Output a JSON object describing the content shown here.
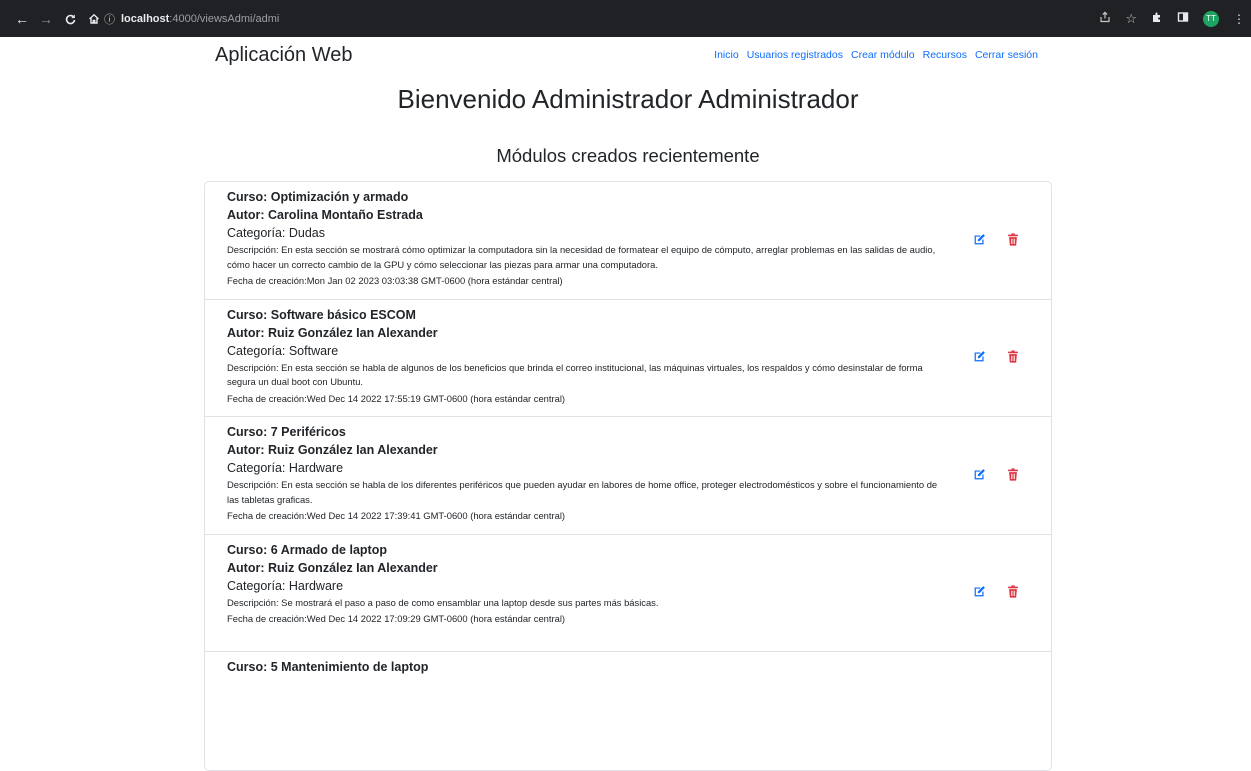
{
  "browser": {
    "url_host": "localhost",
    "url_path": ":4000/viewsAdmi/admi",
    "profile_initials": "TT"
  },
  "navbar": {
    "brand": "Aplicación Web",
    "links": [
      "Inicio",
      "Usuarios registrados",
      "Crear módulo",
      "Recursos",
      "Cerrar sesión"
    ]
  },
  "main": {
    "welcome": "Bienvenido Administrador Administrador",
    "subtitle": "Módulos creados recientemente"
  },
  "modules": [
    {
      "curso": "Curso: Optimización y armado",
      "autor": "Autor: Carolina Montaño Estrada",
      "categoria": "Categoría: Dudas",
      "descripcion": "Descripción: En esta sección se mostrará cómo optimizar la computadora sin la necesidad de formatear el equipo de cómputo, arreglar problemas en las salidas de audio, cómo hacer un correcto cambio de la GPU y cómo seleccionar las piezas para armar una computadora.",
      "fecha": "Fecha de creación:Mon Jan 02 2023 03:03:38 GMT-0600 (hora estándar central)"
    },
    {
      "curso": "Curso: Software básico ESCOM",
      "autor": "Autor: Ruiz González Ian Alexander",
      "categoria": "Categoría: Software",
      "descripcion": "Descripción: En esta sección se habla de algunos de los beneficios que brinda el correo institucional, las máquinas virtuales, los respaldos y cómo desinstalar de forma segura un dual boot con Ubuntu.",
      "fecha": "Fecha de creación:Wed Dec 14 2022 17:55:19 GMT-0600 (hora estándar central)"
    },
    {
      "curso": "Curso: 7 Periféricos",
      "autor": "Autor: Ruiz González Ian Alexander",
      "categoria": "Categoría: Hardware",
      "descripcion": "Descripción: En esta sección se habla de los diferentes periféricos que pueden ayudar en labores de home office, proteger electrodomésticos y sobre el funcionamiento de las tabletas graficas.",
      "fecha": "Fecha de creación:Wed Dec 14 2022 17:39:41 GMT-0600 (hora estándar central)"
    },
    {
      "curso": "Curso: 6 Armado de laptop",
      "autor": "Autor: Ruiz González Ian Alexander",
      "categoria": "Categoría: Hardware",
      "descripcion": "Descripción: Se mostrará el paso a paso de como ensamblar una laptop desde sus partes más básicas.",
      "fecha": "Fecha de creación:Wed Dec 14 2022 17:09:29 GMT-0600 (hora estándar central)"
    },
    {
      "curso": "Curso: 5 Mantenimiento de laptop",
      "autor": "",
      "categoria": "",
      "descripcion": "",
      "fecha": ""
    }
  ],
  "colors": {
    "link": "#0d6efd",
    "edit_icon": "#0d6efd",
    "delete_icon": "#dc3545",
    "chrome_bg": "#202124"
  }
}
